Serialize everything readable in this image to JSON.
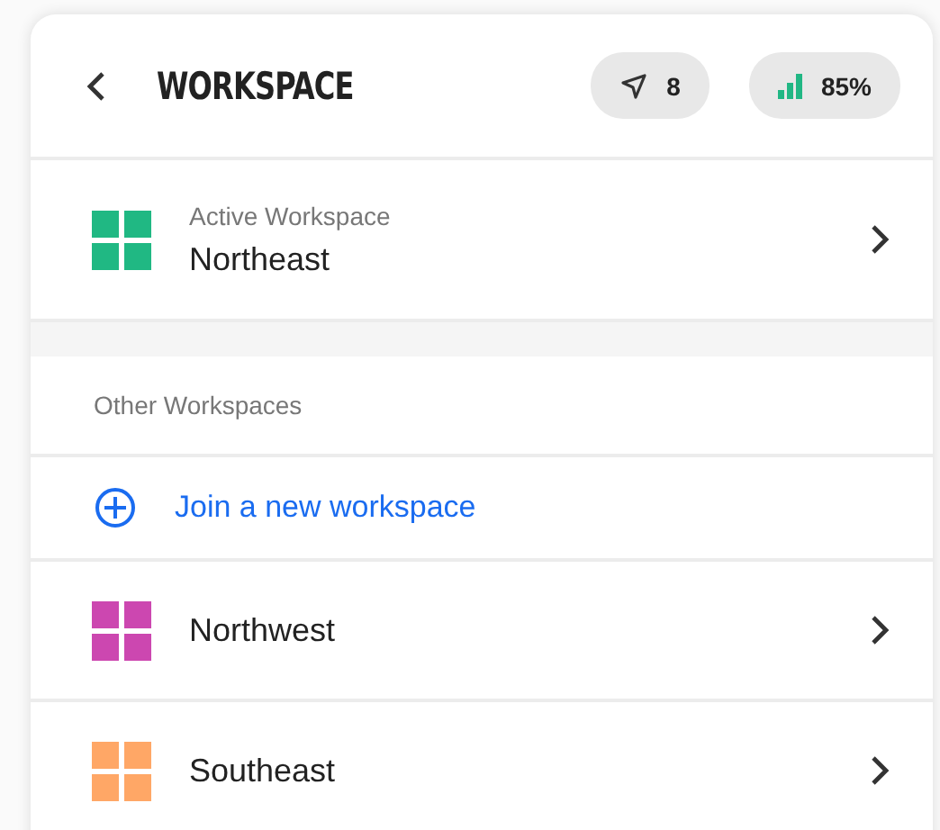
{
  "header": {
    "title": "WORKSPACE",
    "badges": [
      {
        "kind": "location",
        "text": "8"
      },
      {
        "kind": "signal",
        "text": "85%"
      }
    ]
  },
  "active": {
    "caption": "Active Workspace",
    "name": "Northeast",
    "color": "#20b883"
  },
  "other": {
    "heading": "Other Workspaces",
    "join_label": "Join a new workspace",
    "workspaces": [
      {
        "name": "Northwest",
        "color": "#cc47b0"
      },
      {
        "name": "Southeast",
        "color": "#ffa766"
      }
    ]
  }
}
